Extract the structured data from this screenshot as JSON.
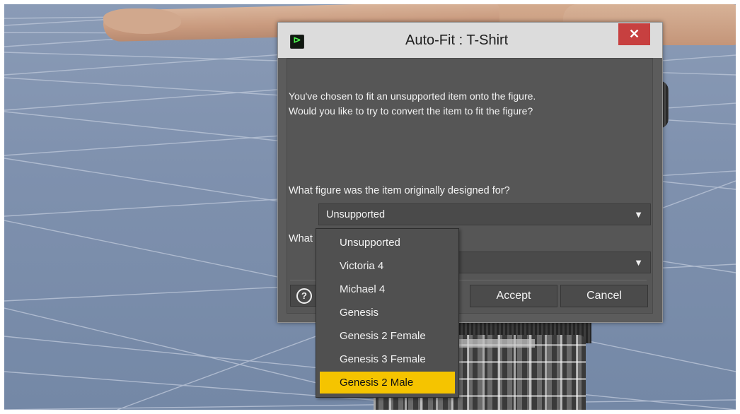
{
  "dialog": {
    "title": "Auto-Fit : T-Shirt",
    "close_glyph": "✕",
    "app_icon_glyph": "⊳",
    "message_line1": "You've chosen to fit an unsupported item onto the figure.",
    "message_line2": "Would you like to try to convert the item to fit the figure?",
    "question1": "What figure was the item originally designed for?",
    "question2_visible": "What",
    "combo1_value": "Unsupported",
    "combo2_value": "",
    "arrow_glyph": "▼",
    "help_glyph": "?",
    "accept_label": "Accept",
    "cancel_label": "Cancel"
  },
  "dropdown": {
    "options": [
      "Unsupported",
      "Victoria 4",
      "Michael 4",
      "Genesis",
      "Genesis 2 Female",
      "Genesis 3 Female",
      "Genesis 2 Male"
    ],
    "highlighted": "Genesis 2 Male"
  },
  "colors": {
    "highlight": "#f5c400",
    "close_button": "#c74040",
    "dialog_body": "#5c5c5c"
  }
}
